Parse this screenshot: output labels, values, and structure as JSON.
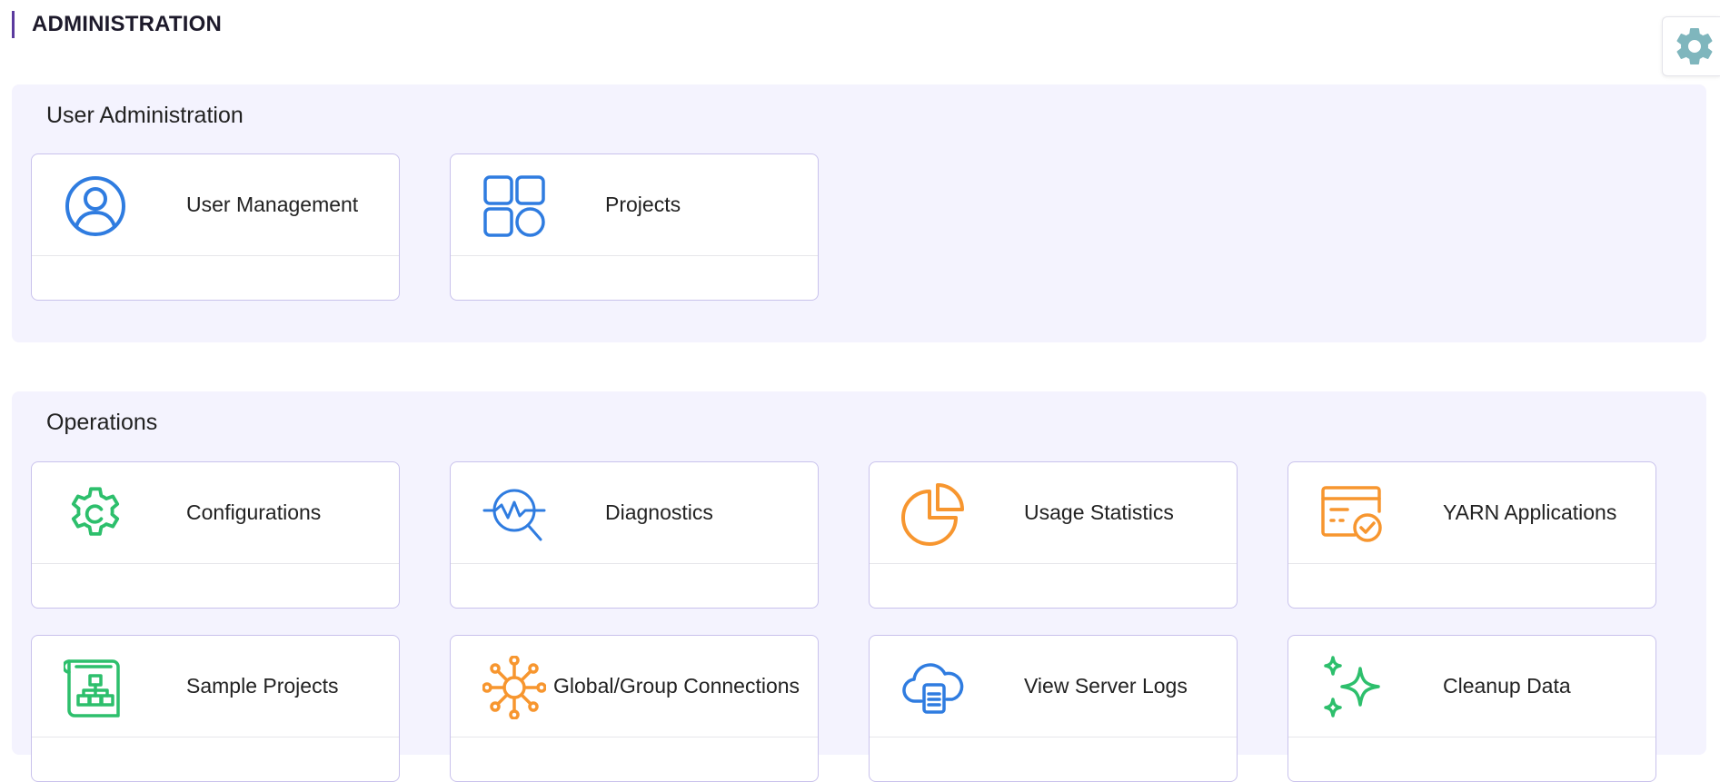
{
  "header": {
    "title": "ADMINISTRATION",
    "accent_color": "#5b3a9e"
  },
  "settings": {
    "icon": "gear-icon",
    "color": "#7fb6bd"
  },
  "sections": [
    {
      "title": "User Administration",
      "cards": [
        {
          "label": "User Management",
          "icon": "user-circle-icon",
          "color": "#2f7ce0"
        },
        {
          "label": "Projects",
          "icon": "grid-shapes-icon",
          "color": "#2f7ce0"
        }
      ]
    },
    {
      "title": "Operations",
      "cards": [
        {
          "label": "Configurations",
          "icon": "config-gear-icon",
          "color": "#2dbf6c"
        },
        {
          "label": "Diagnostics",
          "icon": "diagnostics-magnifier-icon",
          "color": "#2f7ce0"
        },
        {
          "label": "Usage Statistics",
          "icon": "pie-chart-icon",
          "color": "#f7962f"
        },
        {
          "label": "YARN Applications",
          "icon": "app-window-check-icon",
          "color": "#f7962f"
        },
        {
          "label": "Sample Projects",
          "icon": "document-sitemap-icon",
          "color": "#2dbf6c"
        },
        {
          "label": "Global/Group Connections",
          "icon": "network-hub-icon",
          "color": "#f7962f"
        },
        {
          "label": "View Server Logs",
          "icon": "cloud-log-icon",
          "color": "#2f7ce0"
        },
        {
          "label": "Cleanup Data",
          "icon": "sparkles-icon",
          "color": "#2dbf6c"
        }
      ]
    }
  ],
  "colors": {
    "section_bg": "#f4f3fe",
    "card_border": "#c9c2ec",
    "blue": "#2f7ce0",
    "green": "#2dbf6c",
    "orange": "#f7962f"
  }
}
